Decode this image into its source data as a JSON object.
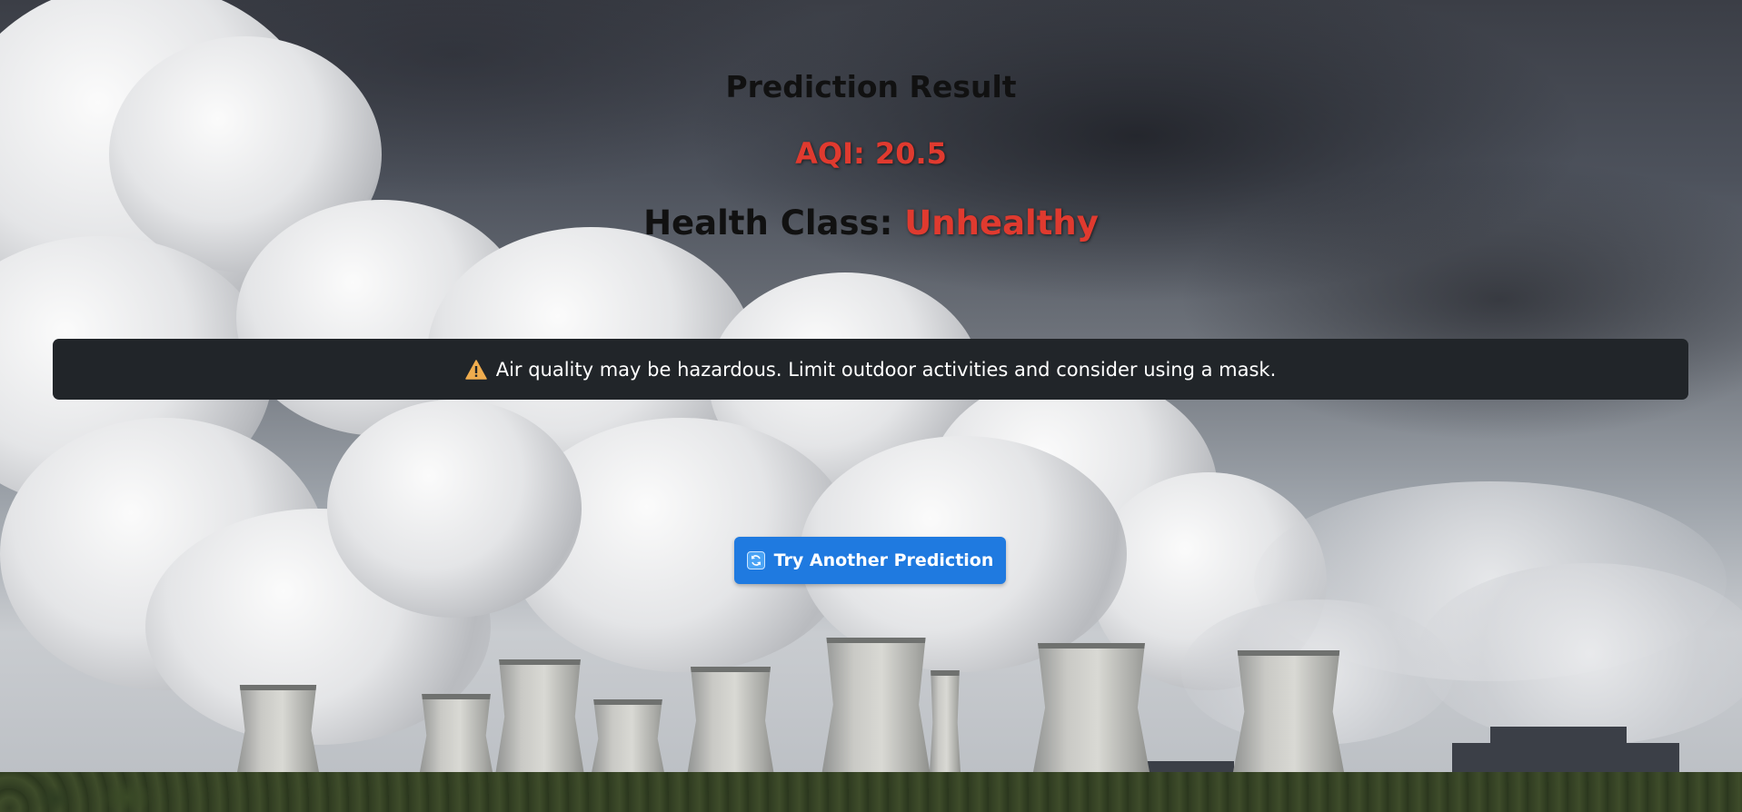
{
  "result": {
    "heading": "Prediction Result",
    "aqi_label": "AQI: 20.5",
    "health_label": "Health Class:",
    "health_value": "Unhealthy"
  },
  "alert": {
    "icon": "warning-icon",
    "message": "Air quality may be hazardous. Limit outdoor activities and consider using a mask."
  },
  "action": {
    "icon": "refresh-icon",
    "button_label": "Try Another Prediction"
  },
  "colors": {
    "danger": "#e03a2f",
    "alert_bg": "#212529",
    "button_bg": "#1f7ae0",
    "warning": "#f0ad4e"
  },
  "background": {
    "description": "background-photo"
  }
}
